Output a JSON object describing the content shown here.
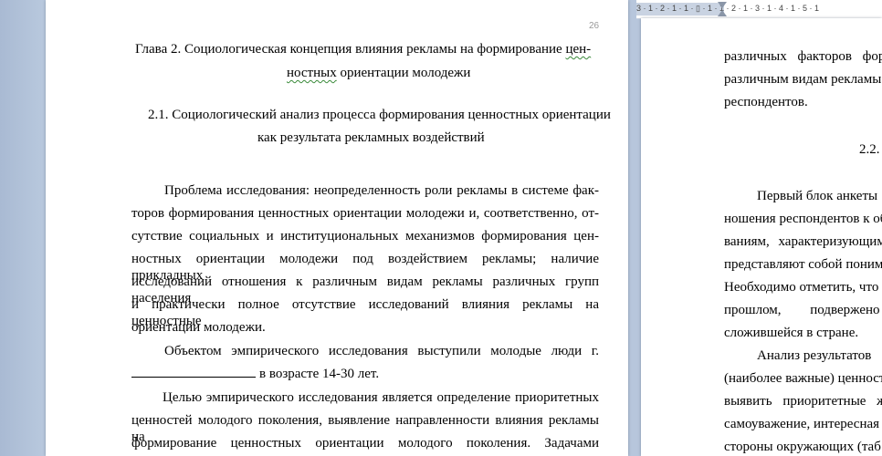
{
  "ruler": {
    "ticks": "3 · 1 · 2 · 1 · 1 · ▯ · 1 · 1 · 2 · 1 · 3 · 1 · 4 · 1 · 5 · 1"
  },
  "left_page": {
    "page_number": "26",
    "title": {
      "line1_a": "Глава 2. Социологическая концепция влияния рекламы на формирование ",
      "line1_b": "цен-",
      "line2_a": "ностных",
      "line2_b": " ориентации молодежи"
    },
    "subtitle": {
      "line1": "2.1. Социологический анализ процесса формирования ценностных ориентации",
      "line2": "как результата рекламных воздействий"
    },
    "body": [
      "Проблема исследования: неопределенность роли рекламы в системе фак-",
      "торов формирования ценностных ориентации молодежи и, соответственно, от-",
      "сутствие социальных и институциональных механизмов формирования цен-",
      "ностных ориентации молодежи под воздействием рекламы; наличие прикладных",
      "исследований отношения к различным видам рекламы различных групп населения",
      "и практически полное отсутствие исследований влияния рекламы на ценностные",
      "ориентации молодежи.",
      "Объектом эмпирического исследования выступили молодые люди г.",
      "в возрасте 14-30 лет.",
      "Целью эмпирического исследования является определение приоритетных",
      "ценностей молодого поколения, выявление направленности влияния рекламы на",
      "формирование ценностных ориентации молодого поколения. Задачами"
    ]
  },
  "right_page": {
    "lines": [
      "различных факторов фор",
      "различным видам рекламы",
      "респондентов.",
      "2.2.",
      "Первый блок анкеты",
      "ношения респондентов к об",
      "ваниям, характеризующим",
      "представляют собой понима",
      "Необходимо отметить, что с",
      "прошлом, подвержено",
      "сложившейся в стране.",
      "Анализ результатов",
      "(наиболее важные) ценност",
      "выявить приоритетные ж",
      "самоуважение, интересная",
      "стороны окружающих (таб"
    ]
  }
}
